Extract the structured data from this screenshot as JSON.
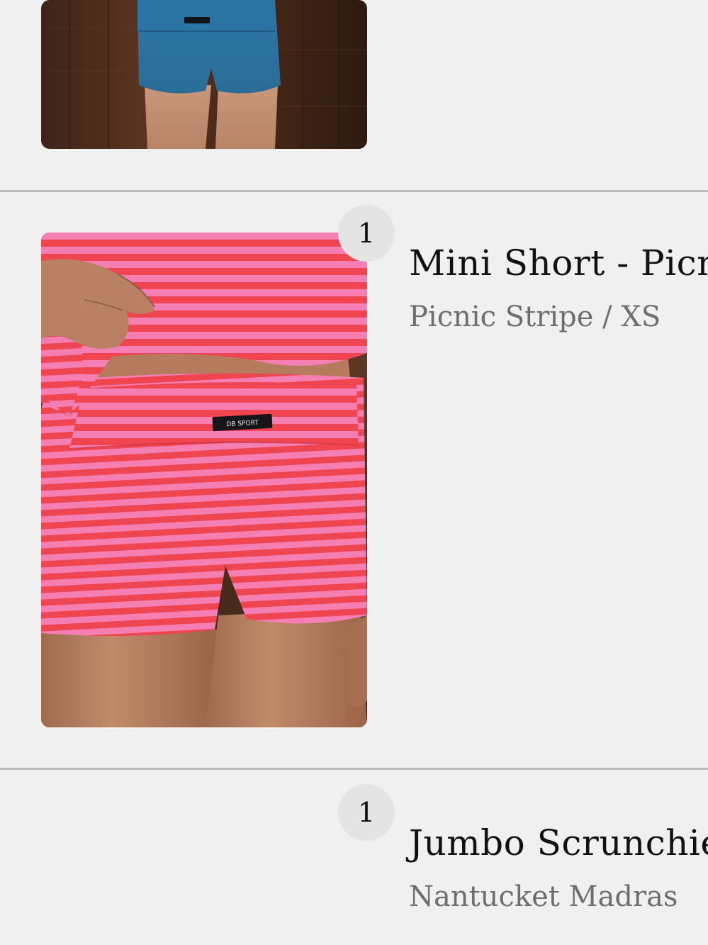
{
  "cart": {
    "items": [
      {
        "image_icon": "product-photo-blue-shorts"
      },
      {
        "quantity": "1",
        "title": "Mini Short - Picnic Stripe",
        "variant": "Picnic Stripe / XS",
        "image_icon": "product-photo-striped-shorts",
        "waistband_label": "DB SPORT"
      },
      {
        "quantity": "1",
        "title": "Jumbo Scrunchie - Nantucket Madras",
        "variant": "Nantucket Madras"
      }
    ]
  },
  "colors": {
    "background": "#f0f0f0",
    "divider": "#bdbab6",
    "badge": "#e4e4e4",
    "title_text": "#111111",
    "variant_text": "#6e6e6e",
    "stripe_pink": "#f57fb3",
    "stripe_red": "#ee4551",
    "denim_blue": "#2f7fb2"
  }
}
